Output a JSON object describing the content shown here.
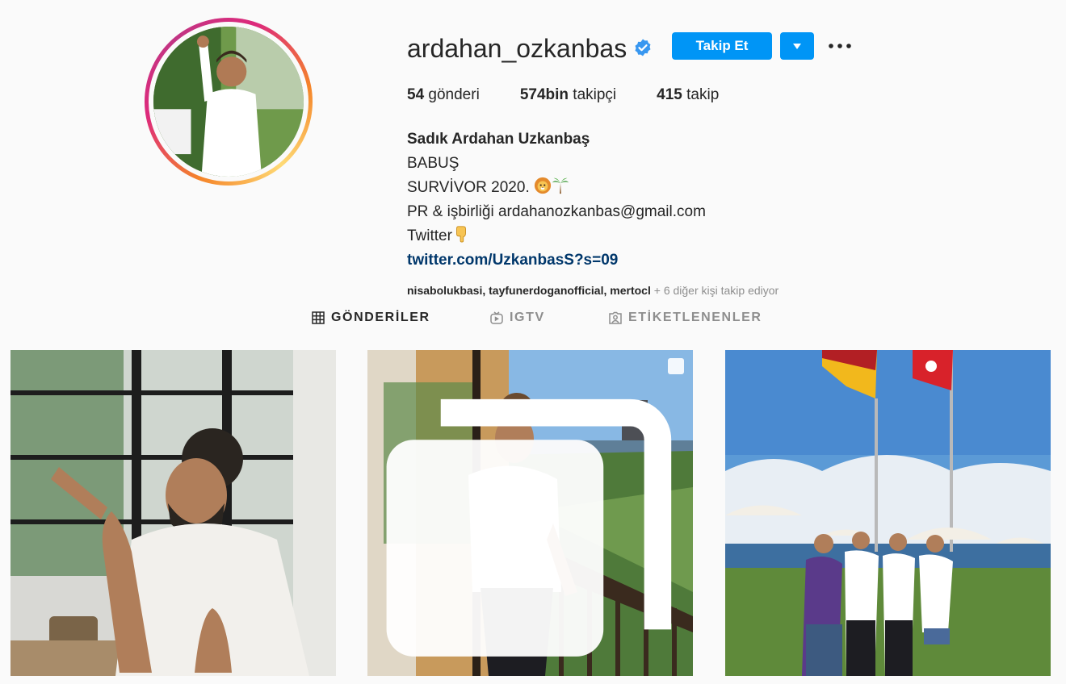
{
  "profile": {
    "username": "ardahan_ozkanbas",
    "follow_label": "Takip Et",
    "stats": [
      {
        "count": "54",
        "label": " gönderi"
      },
      {
        "count": "574bin",
        "label": " takipçi"
      },
      {
        "count": "415",
        "label": " takip"
      }
    ],
    "full_name": "Sadık Ardahan Uzkanbaş",
    "bio_lines": [
      "BABUŞ",
      "SURVİVOR 2020. ",
      "PR & işbirliği ardahanozkanbas@gmail.com",
      "Twitter"
    ],
    "link": "twitter.com/UzkanbasS?s=09",
    "followed_by": {
      "names": [
        "nisabolukbasi",
        "tayfunerdoganofficial",
        "mertocl"
      ],
      "separator": ", ",
      "suffix": " + 6 diğer kişi takip ediyor"
    }
  },
  "tabs": [
    {
      "label": "GÖNDERİLER",
      "icon": "grid-icon",
      "active": true
    },
    {
      "label": "IGTV",
      "icon": "igtv-icon",
      "active": false
    },
    {
      "label": "ETİKETLENENLER",
      "icon": "tagged-icon",
      "active": false
    }
  ],
  "colors": {
    "accent": "#0095f6",
    "link": "#00376b",
    "muted": "#8e8e8e",
    "verified": "#3897f0"
  }
}
